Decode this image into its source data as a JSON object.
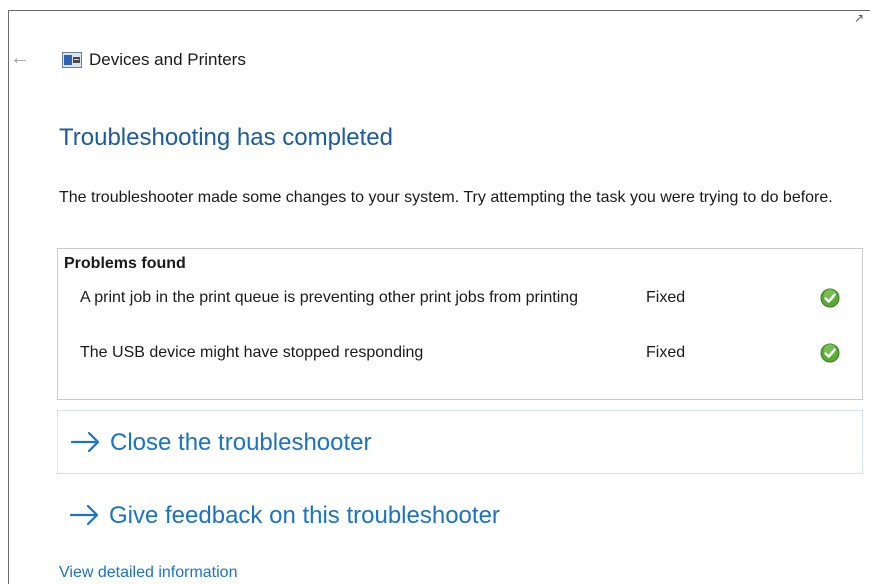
{
  "window": {
    "corner_glyph": "↗"
  },
  "header": {
    "back_icon": "←",
    "icon_name": "devices-printers-icon",
    "title": "Devices and Printers"
  },
  "main": {
    "heading": "Troubleshooting has completed",
    "description": "The troubleshooter made some changes to your system. Try attempting the task you were trying to do before.",
    "problems": {
      "heading": "Problems found",
      "items": [
        {
          "text": "A print job in the print queue is preventing other print jobs from printing",
          "status": "Fixed",
          "icon": "green-check-icon"
        },
        {
          "text": "The USB device might have stopped responding",
          "status": "Fixed",
          "icon": "green-check-icon"
        }
      ]
    },
    "actions": {
      "close_label": "Close the troubleshooter",
      "feedback_label": "Give feedback on this troubleshooter"
    },
    "detail_link": "View detailed information"
  },
  "colors": {
    "heading": "#1b5b9e",
    "link": "#1b73c5",
    "check": "#5aa83a",
    "box_border": "#c9c9c9",
    "hover_border": "#cfe3f5"
  }
}
